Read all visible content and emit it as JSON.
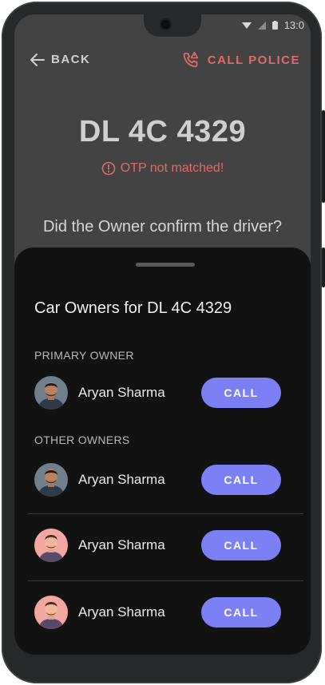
{
  "status": {
    "time": "13:0"
  },
  "nav": {
    "back_label": "BACK",
    "call_police_label": "CALL POLICE"
  },
  "vehicle": {
    "plate": "DL 4C 4329"
  },
  "alert": {
    "otp_error": "OTP not matched!"
  },
  "prompt": {
    "question": "Did the Owner confirm the driver?"
  },
  "sheet": {
    "title": "Car Owners for DL 4C 4329",
    "primary_heading": "PRIMARY OWNER",
    "other_heading": "OTHER OWNERS",
    "primary_owner": {
      "name": "Aryan Sharma",
      "call_label": "CALL"
    },
    "other_owners": [
      {
        "name": "Aryan Sharma",
        "call_label": "CALL"
      },
      {
        "name": "Aryan Sharma",
        "call_label": "CALL"
      },
      {
        "name": "Aryan Sharma",
        "call_label": "CALL"
      }
    ]
  },
  "colors": {
    "accent": "#7b80f5",
    "alert": "#e06a6a",
    "sheet_bg": "#121212",
    "screen_bg": "#434343"
  }
}
